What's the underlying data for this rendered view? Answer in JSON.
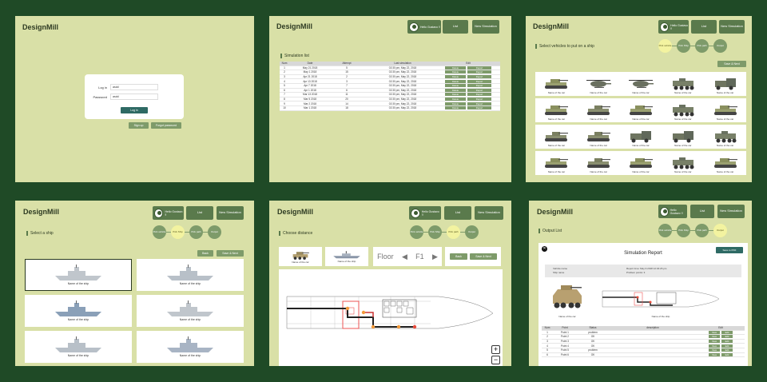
{
  "app": {
    "logo": "DesignMill"
  },
  "header": {
    "user": "Hello Gustavo !!",
    "list": "List",
    "new_sim": "New Simulation"
  },
  "steps": [
    "Pick vehicle",
    "Pick Ship",
    "Pick path",
    "Output"
  ],
  "login": {
    "login_label": "Log in",
    "login_value": "asdd",
    "password_label": "Password",
    "password_value": "asdd",
    "submit": "Log in",
    "sign_up": "Sign up",
    "forgot": "Forgot password"
  },
  "sim_list": {
    "title": "Simulation list",
    "columns": [
      "Num",
      "Date",
      "Attempt",
      "Last simulation",
      "Edit"
    ],
    "delete": "Delete",
    "report": "Report",
    "rows": [
      [
        "1",
        "May 21 2018",
        "5",
        "02:30 pm, May 22, 2018"
      ],
      [
        "2",
        "May 1 2018",
        "15",
        "02:30 pm, May 22, 2018"
      ],
      [
        "3",
        "Apr 21 2018",
        "2",
        "02:30 pm, May 22, 2018"
      ],
      [
        "4",
        "Apr 13 2018",
        "3",
        "02:30 pm, May 22, 2018"
      ],
      [
        "5",
        "Apr 7 2018",
        "7",
        "02:30 pm, May 22, 2018"
      ],
      [
        "6",
        "Apr 1 2018",
        "6",
        "02:30 pm, May 22, 2018"
      ],
      [
        "7",
        "Mar 13 2018",
        "11",
        "02:30 pm, May 22, 2018"
      ],
      [
        "8",
        "Mar 5 2018",
        "20",
        "02:30 pm, May 22, 2018"
      ],
      [
        "9",
        "Mar 2 2018",
        "14",
        "02:30 pm, May 22, 2018"
      ],
      [
        "10",
        "Mar 1 2018",
        "18",
        "02:30 pm, May 22, 2018"
      ]
    ]
  },
  "vehicles": {
    "title": "Select vehicles to put on a ship",
    "save_next": "Save & Next",
    "item_label": "Name of the car"
  },
  "ships": {
    "title": "Select a ship",
    "back": "Back",
    "save_next": "Save & Next",
    "item_label": "Name of the ship"
  },
  "distance": {
    "title": "Choose distance",
    "car": "Name of the car",
    "ship": "Name of the ship",
    "floor": "Floor",
    "floor_value": "F1",
    "back": "Back",
    "save_next": "Save & Next",
    "zoom_in": "+",
    "zoom_out": "−"
  },
  "output": {
    "title": "Output List",
    "report_title": "Simulation Report",
    "save_pdf": "Save to PDF",
    "vehicle_name": "Vehicle name",
    "ship_name": "Ship name",
    "report_time": "Report time: May 9 2018 12:34:26 pm",
    "problem_points": "Problem points: 3",
    "car": "Name of the car",
    "ship": "Name of the ship",
    "columns": [
      "Num",
      "Point",
      "Status",
      "description",
      "Edit"
    ],
    "view": "View",
    "edit": "Edit",
    "rows": [
      [
        "1",
        "Point 1",
        "problem"
      ],
      [
        "2",
        "Point 2",
        "OK"
      ],
      [
        "3",
        "Point 3",
        "OK"
      ],
      [
        "4",
        "Point 4",
        "OK"
      ],
      [
        "5",
        "Point 5",
        "problem"
      ],
      [
        "6",
        "Point 6",
        "OK"
      ]
    ]
  }
}
